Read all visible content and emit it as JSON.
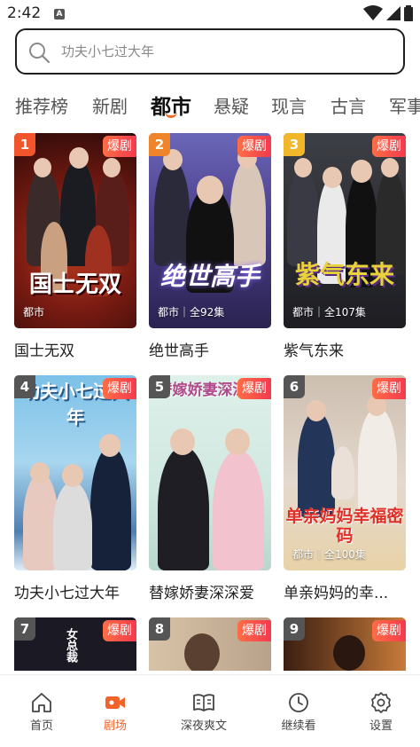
{
  "status": {
    "time": "2:42",
    "app_icon": "A"
  },
  "search": {
    "placeholder": "功夫小七过大年"
  },
  "tabs": [
    {
      "label": "推荐榜"
    },
    {
      "label": "新剧"
    },
    {
      "label": "都市",
      "active": true
    },
    {
      "label": "悬疑"
    },
    {
      "label": "现言"
    },
    {
      "label": "古言"
    },
    {
      "label": "军事"
    }
  ],
  "badge_label": "爆剧",
  "items": [
    {
      "rank": "1",
      "title": "国士无双",
      "meta": "都市",
      "art": "国士无双",
      "rank_color": "#f0552b"
    },
    {
      "rank": "2",
      "title": "绝世高手",
      "meta": "都市｜全92集",
      "art": "绝世高手",
      "rank_color": "#f0842b"
    },
    {
      "rank": "3",
      "title": "紫气东来",
      "meta": "都市｜全107集",
      "art": "紫气东来",
      "rank_color": "#f0b72b"
    },
    {
      "rank": "4",
      "title": "功夫小七过大年",
      "meta": "",
      "art": "功夫小七过大年",
      "rank_color": "#555555"
    },
    {
      "rank": "5",
      "title": "替嫁娇妻深深爱",
      "meta": "",
      "art": "替嫁娇妻深深爱",
      "rank_color": "#555555"
    },
    {
      "rank": "6",
      "title": "单亲妈妈的幸...",
      "meta": "都市｜全100集",
      "art": "单亲妈妈幸福密码",
      "rank_color": "#555555"
    },
    {
      "rank": "7",
      "title": "",
      "meta": "",
      "art": "女总裁",
      "rank_color": "#555555"
    },
    {
      "rank": "8",
      "title": "",
      "meta": "",
      "art": "",
      "rank_color": "#555555"
    },
    {
      "rank": "9",
      "title": "",
      "meta": "",
      "art": "",
      "rank_color": "#555555"
    }
  ],
  "nav": [
    {
      "label": "首页",
      "icon": "home-icon"
    },
    {
      "label": "剧场",
      "icon": "theater-icon",
      "active": true
    },
    {
      "label": "深夜爽文",
      "icon": "book-icon"
    },
    {
      "label": "继续看",
      "icon": "clock-icon"
    },
    {
      "label": "设置",
      "icon": "gear-icon"
    }
  ],
  "colors": {
    "accent": "#f0642a",
    "badge": "#f33a4f"
  }
}
